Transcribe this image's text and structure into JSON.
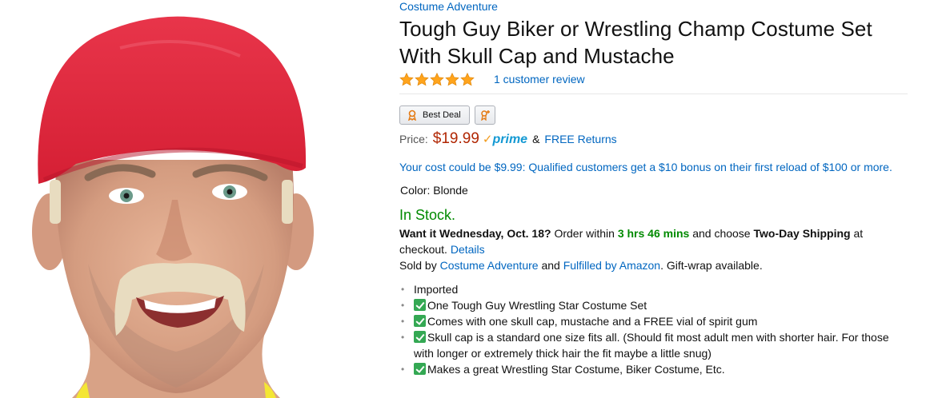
{
  "brand": "Costume Adventure",
  "title_line1": "Tough Guy Biker or Wrestling Champ Costume Set",
  "title_line2": "With Skull Cap and Mustache",
  "rating": {
    "stars": 5,
    "review_text": "1 customer review"
  },
  "badges": {
    "best_deal": "Best Deal"
  },
  "price": {
    "label": "Price:",
    "amount": "$19.99",
    "prime": "prime",
    "amp": "&",
    "free_returns": "FREE Returns"
  },
  "cost_line": "Your cost could be $9.99: Qualified customers get a $10 bonus on their first reload of $100 or more.",
  "color": {
    "label": "Color:",
    "value": "Blonde"
  },
  "stock": "In Stock.",
  "delivery": {
    "want_it": "Want it Wednesday, Oct. 18?",
    "order_within": "Order within",
    "time": "3 hrs 46 mins",
    "and_choose": "and choose",
    "shipping": "Two-Day Shipping",
    "at_checkout": "at checkout.",
    "details": "Details",
    "sold_by": "Sold by",
    "seller": "Costume Adventure",
    "and": "and",
    "fulfilled": "Fulfilled by Amazon",
    "gift": ". Gift-wrap available."
  },
  "bullets": [
    "Imported",
    "One Tough Guy Wrestling Star Costume Set",
    "Comes with one skull cap, mustache and a FREE vial of spirit gum",
    "Skull cap is a standard one size fits all. (Should fit most adult men with shorter hair. For those with longer or extremely thick hair the fit maybe a little snug)",
    "Makes a great Wrestling Star Costume, Biker Costume, Etc."
  ],
  "colors": {
    "link": "#0066c0",
    "price": "#b12704",
    "in_stock": "#008a00",
    "star": "#ffa41c",
    "prime": "#1399d3"
  }
}
